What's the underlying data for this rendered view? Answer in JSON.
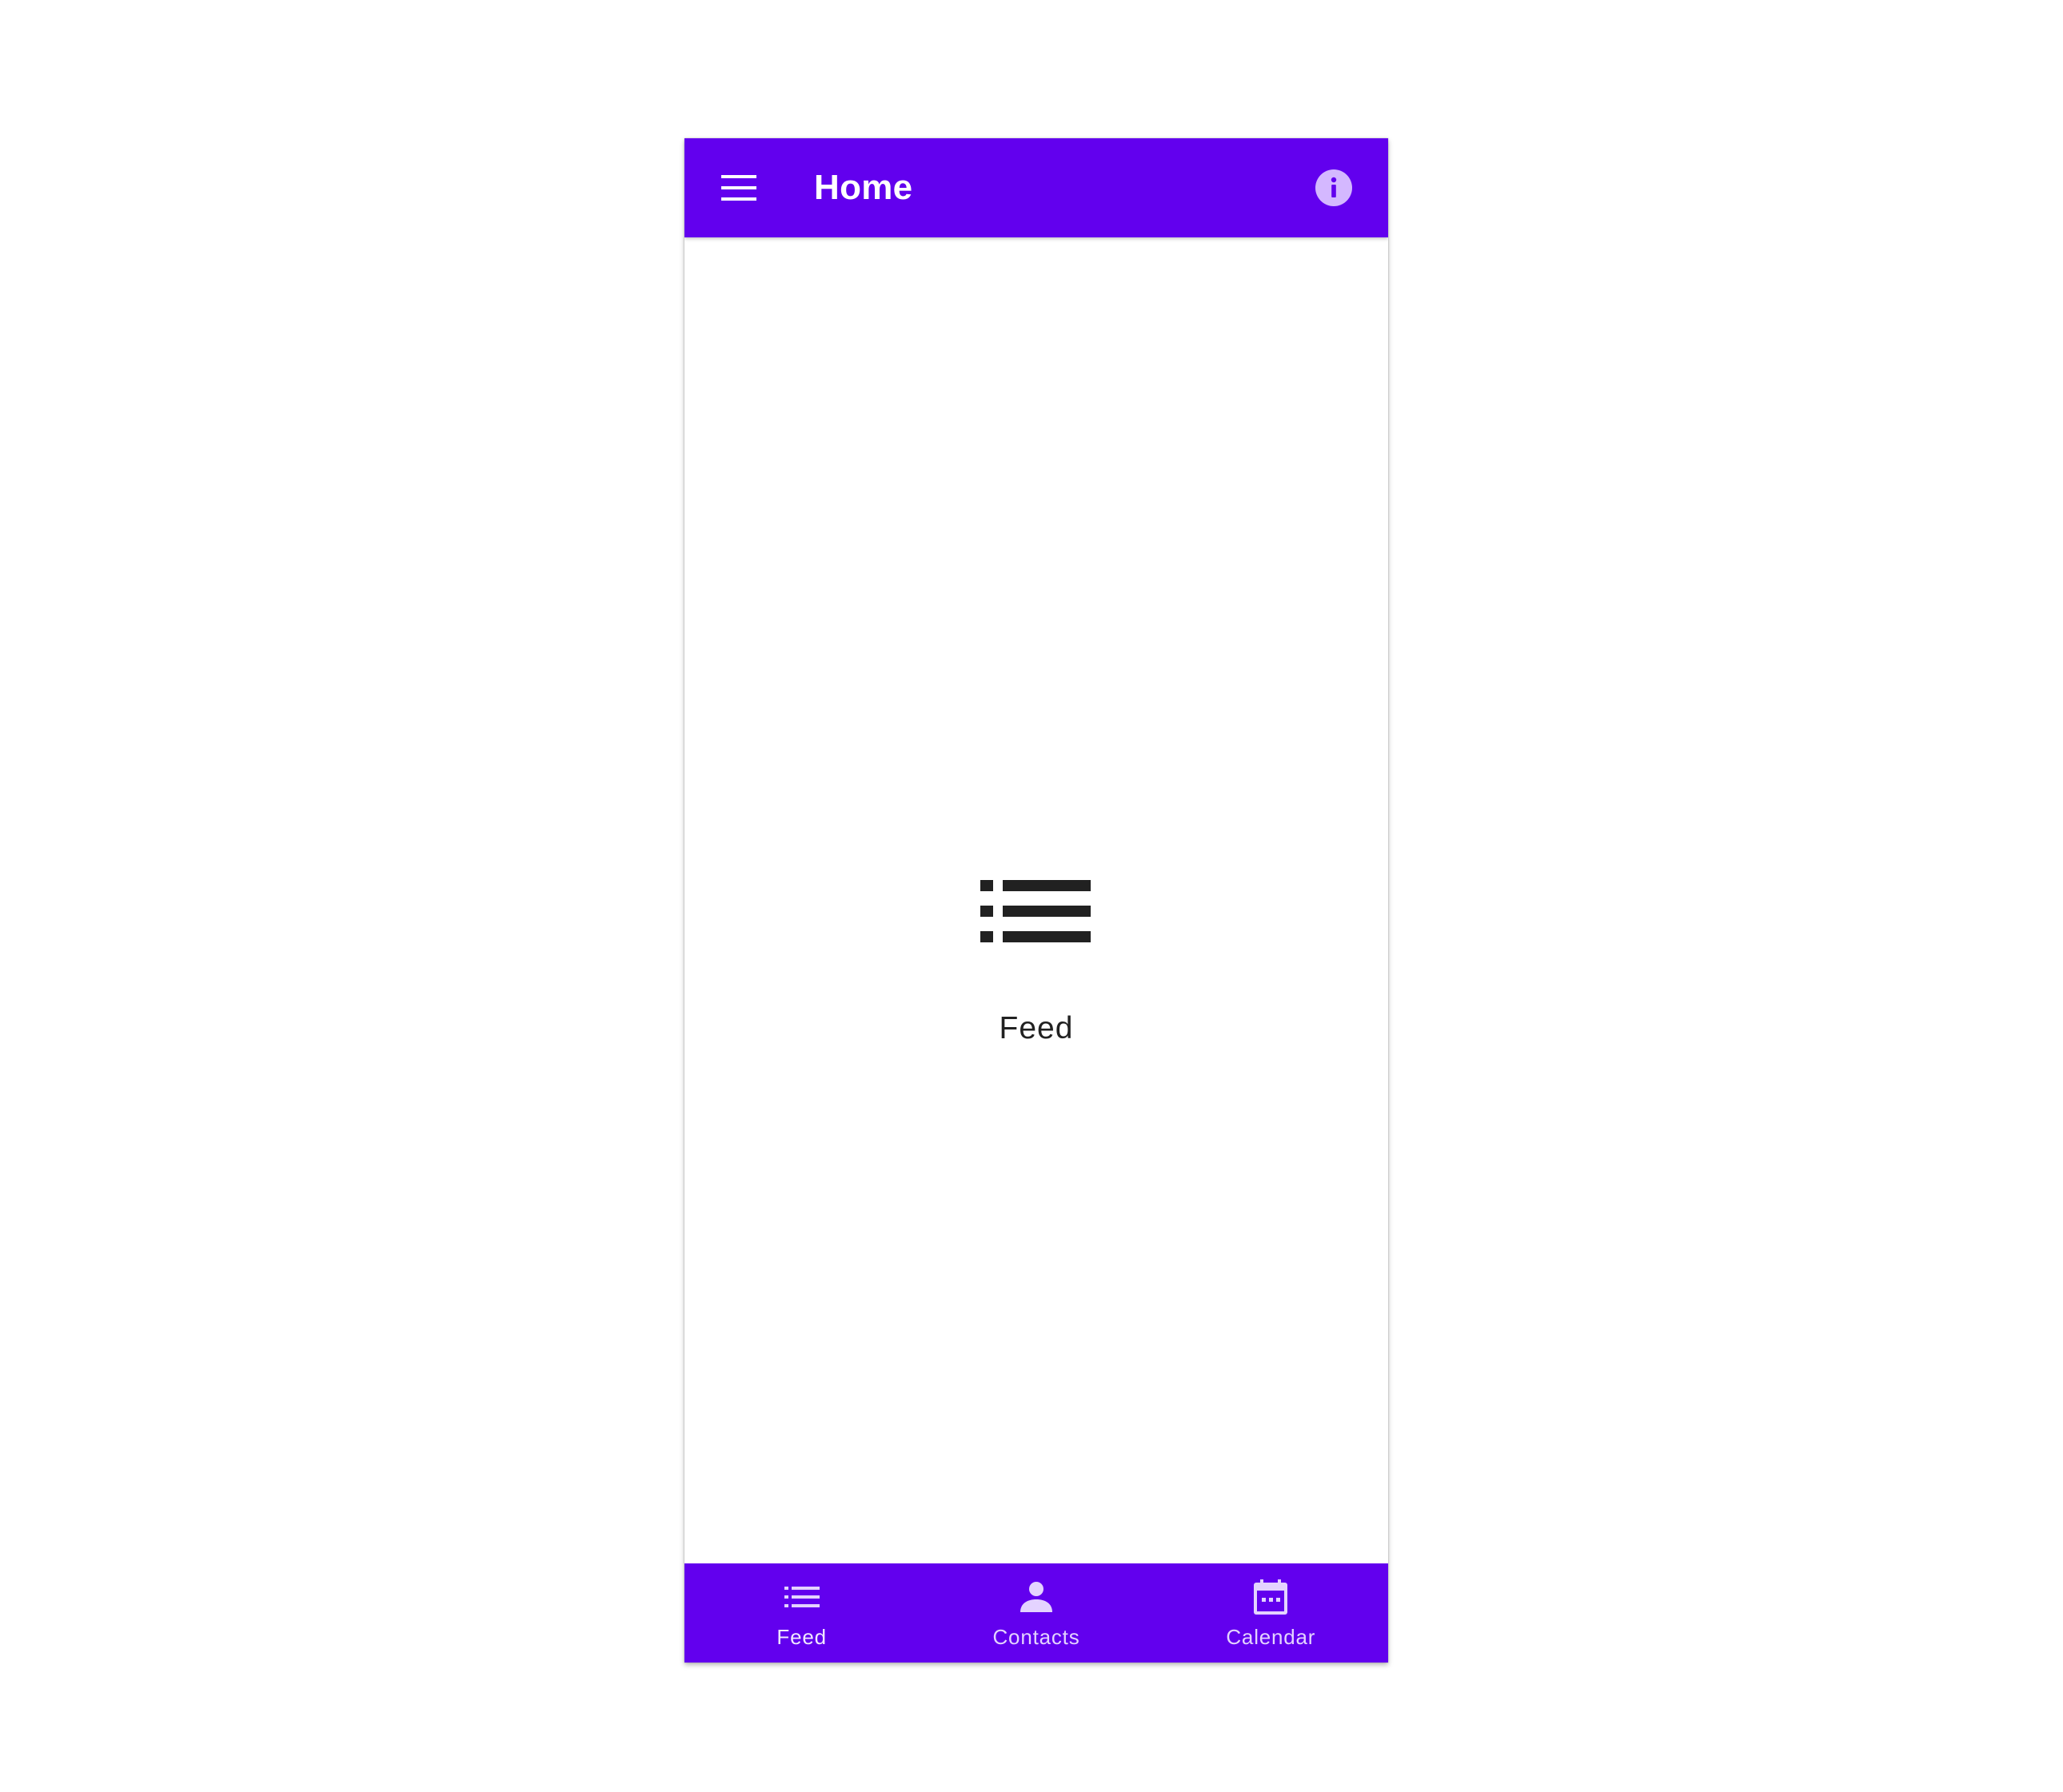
{
  "app_bar": {
    "title": "Home",
    "menu_icon": "menu-icon",
    "info_icon": "info-icon"
  },
  "main": {
    "icon": "list-icon",
    "label": "Feed"
  },
  "bottom_nav": {
    "items": [
      {
        "label": "Feed",
        "icon": "list-icon",
        "active": true
      },
      {
        "label": "Contacts",
        "icon": "person-icon",
        "active": false
      },
      {
        "label": "Calendar",
        "icon": "calendar-icon",
        "active": false
      }
    ]
  },
  "colors": {
    "primary": "#6200ee",
    "background": "#ffffff",
    "text": "#212121",
    "nav_label": "#e4d3ff",
    "info_icon_fill": "#d4b8ff"
  }
}
